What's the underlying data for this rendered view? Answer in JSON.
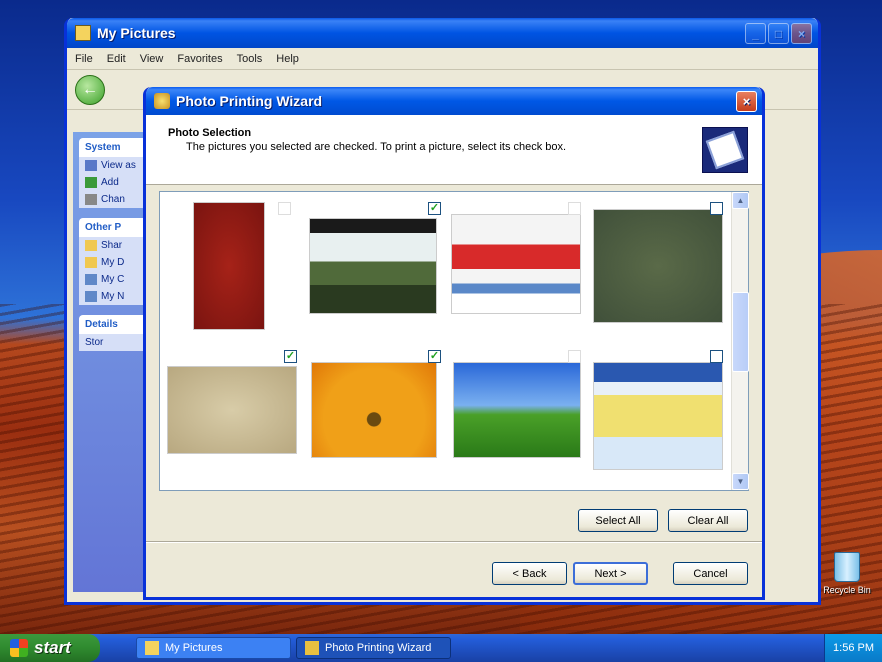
{
  "bg_window": {
    "title": "My Pictures",
    "menu": [
      "File",
      "Edit",
      "View",
      "Favorites",
      "Tools",
      "Help"
    ],
    "sidebar": {
      "panels": [
        {
          "header": "System",
          "items": [
            "View as",
            "Add",
            "Chan"
          ]
        },
        {
          "header": "Other P",
          "items": [
            "Shar",
            "My D",
            "My C",
            "My N"
          ]
        },
        {
          "header": "Details",
          "items": [
            "Stor"
          ]
        }
      ]
    }
  },
  "wizard": {
    "title": "Photo Printing Wizard",
    "header_title": "Photo Selection",
    "header_subtitle": "The pictures you selected are checked. To print a picture, select its check box.",
    "thumbnails": [
      {
        "name": "red-texture",
        "checked": false
      },
      {
        "name": "tree-landscape",
        "checked": true
      },
      {
        "name": "web-screenshot-red",
        "checked": false
      },
      {
        "name": "green-texture",
        "checked": false
      },
      {
        "name": "dried-flowers",
        "checked": true
      },
      {
        "name": "orange-flower",
        "checked": true
      },
      {
        "name": "bliss-hill",
        "checked": false
      },
      {
        "name": "web-screenshot-blue",
        "checked": false
      }
    ],
    "buttons": {
      "select_all": "Select All",
      "clear_all": "Clear All",
      "back": "< Back",
      "next": "Next >",
      "cancel": "Cancel"
    }
  },
  "taskbar": {
    "start_label": "start",
    "tasks": [
      "My Pictures",
      "Photo Printing Wizard"
    ],
    "clock": "1:56 PM"
  },
  "desktop": {
    "recycle_bin": "Recycle Bin"
  }
}
